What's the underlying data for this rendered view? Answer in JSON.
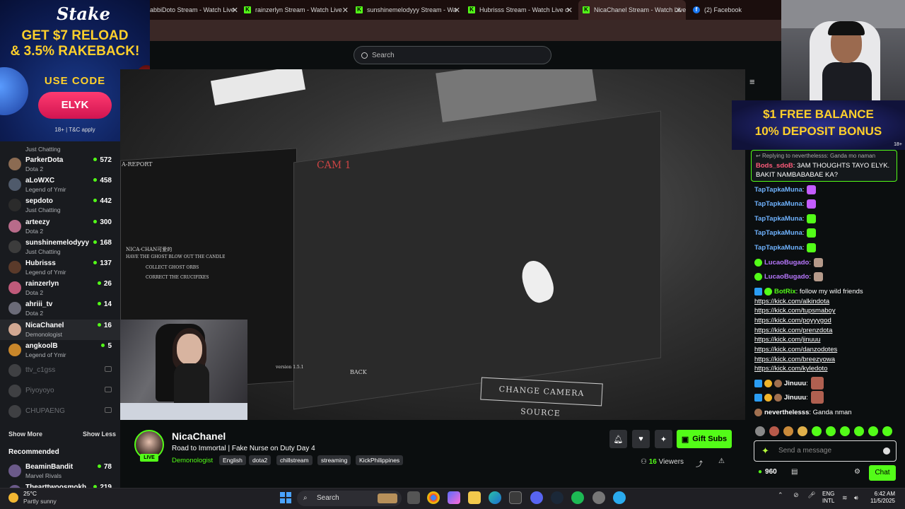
{
  "browser": {
    "tabs": [
      {
        "label": "abbiDoto Stream - Watch Live",
        "active": false
      },
      {
        "label": "rainzerlyn Stream - Watch Live",
        "active": false
      },
      {
        "label": "sunshinemelodyyy Stream - Wa",
        "active": false
      },
      {
        "label": "Hubrisss Stream - Watch Live o",
        "active": false
      },
      {
        "label": "NicaChanel Stream - Watch Live",
        "active": true
      },
      {
        "label": "(2) Facebook",
        "active": false
      }
    ]
  },
  "search": {
    "placeholder": "Search"
  },
  "ad_left": {
    "logo": "Stake",
    "headline1": "GET $7 RELOAD",
    "headline2": "& 3.5% RAKEBACK!",
    "use_code": "USE CODE",
    "code": "ELYK",
    "terms": "18+ | T&C apply"
  },
  "sidebar": {
    "partial_item": "Just Chatting",
    "channels": [
      {
        "name": "ParkerDota",
        "category": "Dota 2",
        "viewers": "572",
        "avatar_color": "#8b6b52"
      },
      {
        "name": "aLoWXC",
        "category": "Legend of Ymir",
        "viewers": "458",
        "avatar_color": "#4f5a6b"
      },
      {
        "name": "sepdoto",
        "category": "Just Chatting",
        "viewers": "442",
        "avatar_color": "#2b2b2b"
      },
      {
        "name": "arteezy",
        "category": "Dota 2",
        "viewers": "300",
        "avatar_color": "#b86b8a"
      },
      {
        "name": "sunshinemelodyyy",
        "category": "Just Chatting",
        "viewers": "168",
        "avatar_color": "#3c3c3c"
      },
      {
        "name": "Hubrisss",
        "category": "Legend of Ymir",
        "viewers": "137",
        "avatar_color": "#5a3a2a"
      },
      {
        "name": "rainzerlyn",
        "category": "Dota 2",
        "viewers": "26",
        "avatar_color": "#c05a7a"
      },
      {
        "name": "ahriii_tv",
        "category": "Dota 2",
        "viewers": "14",
        "avatar_color": "#6b6b78"
      },
      {
        "name": "NicaChanel",
        "category": "Demonologist",
        "viewers": "16",
        "avatar_color": "#d2a892"
      },
      {
        "name": "angkoolB",
        "category": "Legend of Ymir",
        "viewers": "5",
        "avatar_color": "#c8862a"
      }
    ],
    "offline": [
      "ttv_c1gss",
      "Piyoyoyo",
      "CHUPAENG"
    ],
    "show_more": "Show More",
    "show_less": "Show Less",
    "recommended_heading": "Recommended",
    "recommended": [
      {
        "name": "BeaminBandit",
        "category": "Marvel Rivals",
        "viewers": "78"
      },
      {
        "name": "Thearttwoosmokh",
        "category": "",
        "viewers": "219"
      }
    ]
  },
  "video": {
    "report_label": "A-REPORT",
    "cam_label": "CAM 1",
    "task_title": "NICA-CHAN可爱的",
    "tasks": [
      "HAVE THE GHOST BLOW OUT THE CANDLE",
      "COLLECT GHOST ORBS",
      "CORRECT THE CRUCIFIXES"
    ],
    "back_label": "BACK",
    "version": "version 1.5.1",
    "camera_button": "CHANGE CAMERA SOURCE"
  },
  "stream": {
    "channel": "NicaChanel",
    "live": "LIVE",
    "title": "Road to Immortal | Fake Nurse on Duty Day 4",
    "category": "Demonologist",
    "tags": [
      "English",
      "dota2",
      "chillstream",
      "streaming",
      "KickPhilippines"
    ],
    "gift_subs": "Gift Subs",
    "viewer_count": "16",
    "viewers_label": "Viewers"
  },
  "ad_right": {
    "line1": "$1 FREE BALANCE",
    "line2": "10% DEPOSIT BONUS",
    "age": "18+"
  },
  "chat": {
    "pinned": {
      "reply": "Replying to neverthelesss: Ganda mo naman",
      "user": "Bods_sdoB",
      "text": "3AM THOUGHTS TAYO ELYK. BAKIT NAMBABABAE KA?"
    },
    "messages": [
      {
        "user": "TapTapkaMuna",
        "color": "#6fb3ff",
        "text": ""
      },
      {
        "user": "TapTapkaMuna",
        "color": "#6fb3ff",
        "text": ""
      },
      {
        "user": "TapTapkaMuna",
        "color": "#6fb3ff",
        "text": ""
      },
      {
        "user": "TapTapkaMuna",
        "color": "#6fb3ff",
        "text": ""
      },
      {
        "user": "TapTapkaMuna",
        "color": "#6fb3ff",
        "text": ""
      },
      {
        "user": "LucaoBugado",
        "color": "#b978ff",
        "text": ""
      },
      {
        "user": "LucaoBugado",
        "color": "#b978ff",
        "text": ""
      },
      {
        "user": "BotRix",
        "color": "#53fc18",
        "text": "follow my wild friends"
      },
      {
        "user": "Jinuuu",
        "color": "#ffffff",
        "text": ""
      },
      {
        "user": "Jinuuu",
        "color": "#ffffff",
        "text": ""
      },
      {
        "user": "neverthelesss",
        "color": "#ffffff",
        "text": "Ganda nman"
      }
    ],
    "links": [
      "https://kick.com/alkindota",
      "https://kick.com/tupsmaboy",
      "https://kick.com/poyyygod",
      "https://kick.com/prenzdota",
      "https://kick.com/jinuuu",
      "https://kick.com/danzodotes",
      "https://kick.com/breezyowa",
      "https://kick.com/kyledoto"
    ],
    "input_placeholder": "Send a message",
    "points": "960",
    "chat_button": "Chat"
  },
  "taskbar": {
    "temperature": "25°C",
    "condition": "Partly sunny",
    "search": "Search",
    "lang1": "ENG",
    "lang2": "INTL",
    "time": "6:42 AM",
    "date": "11/5/2025"
  },
  "colors": {
    "kick_green": "#53fc18",
    "bg": "#0b0e0f",
    "sidebar": "#191b1f"
  }
}
